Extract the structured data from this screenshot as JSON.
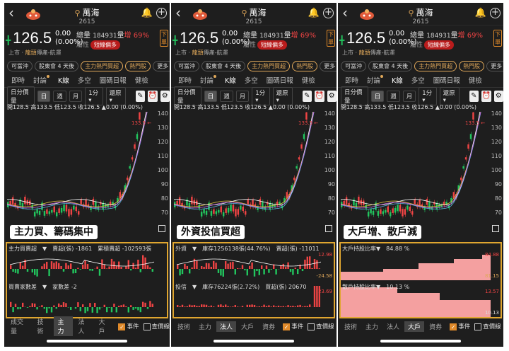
{
  "stock": {
    "name": "萬海",
    "code": "2615",
    "price": "126.5",
    "change": "0.00",
    "change_pct": "(0.00%)",
    "volume_label": "總量",
    "volume": "184931",
    "volume_unit": "量",
    "volume_ratio": "增 69%",
    "attr_label": "屬性",
    "badge": "短線偏多",
    "market": "上市 ·",
    "industry_hot": "龍頭",
    "industry": "傳產-航運",
    "side_flag": "下單",
    "ohlc": "開128.5 高133.5 低123.5 收126.5 ▲0.00 (0.00%)"
  },
  "tags": [
    "可當沖",
    "股東會 4 天後",
    "主力熱門買超",
    "熱門股",
    "更多 ›"
  ],
  "tabs": [
    "即時",
    "討論",
    "K線",
    "多空",
    "圖碼日報",
    "健檢"
  ],
  "toolbar": {
    "period": "日分價量",
    "day": "日",
    "week": "週",
    "month": "月",
    "minute": "1分▾",
    "adjust": "還原▾"
  },
  "y_axis": [
    "140",
    "130",
    "120",
    "110",
    "100",
    "90",
    "80",
    "70"
  ],
  "price_mark": "133.5",
  "panels": [
    {
      "caption": "主力買、籌碼集中",
      "line1": "主力買賣超　▼　賣超(張) -1861　累積賣超 -102593張",
      "line2": "買賣家數差　▼　家數差 -2",
      "r1": "",
      "r2": "",
      "r3": "",
      "r4": "",
      "bottom_tabs": [
        "成交量",
        "技術",
        "主力",
        "法人",
        "大戶"
      ],
      "active": "主力"
    },
    {
      "caption": "外資投信買超",
      "line1": "外資　▼　庫存1256138張(44.76%)　賣超(張) -11011",
      "line2": "投信　▼　庫存76224張(2.72%)　買超(張) 20670",
      "r1": "12.98",
      "r2": "-24.58",
      "r3": "23.69",
      "r4": "",
      "bottom_tabs": [
        "技術",
        "主力",
        "法人",
        "大戶",
        "資券"
      ],
      "active": "法人"
    },
    {
      "caption": "大戶增、散戶減",
      "line1": "大戶持股比率▼　84.88 %",
      "line2": "散戶持股比率▼　10.13 %",
      "r1": "84.88",
      "r2": "81.15",
      "r3": "13.57",
      "r4": "10.13",
      "bottom_tabs": [
        "技術",
        "主力",
        "法人",
        "大戶",
        "資券"
      ],
      "active": "大戶"
    }
  ],
  "checks": {
    "event": "事件",
    "price": "查價線"
  },
  "colors": {
    "up": "#ef4444",
    "down": "#22c55e",
    "accent": "#e0a630",
    "bg": "#1e1e1e"
  }
}
